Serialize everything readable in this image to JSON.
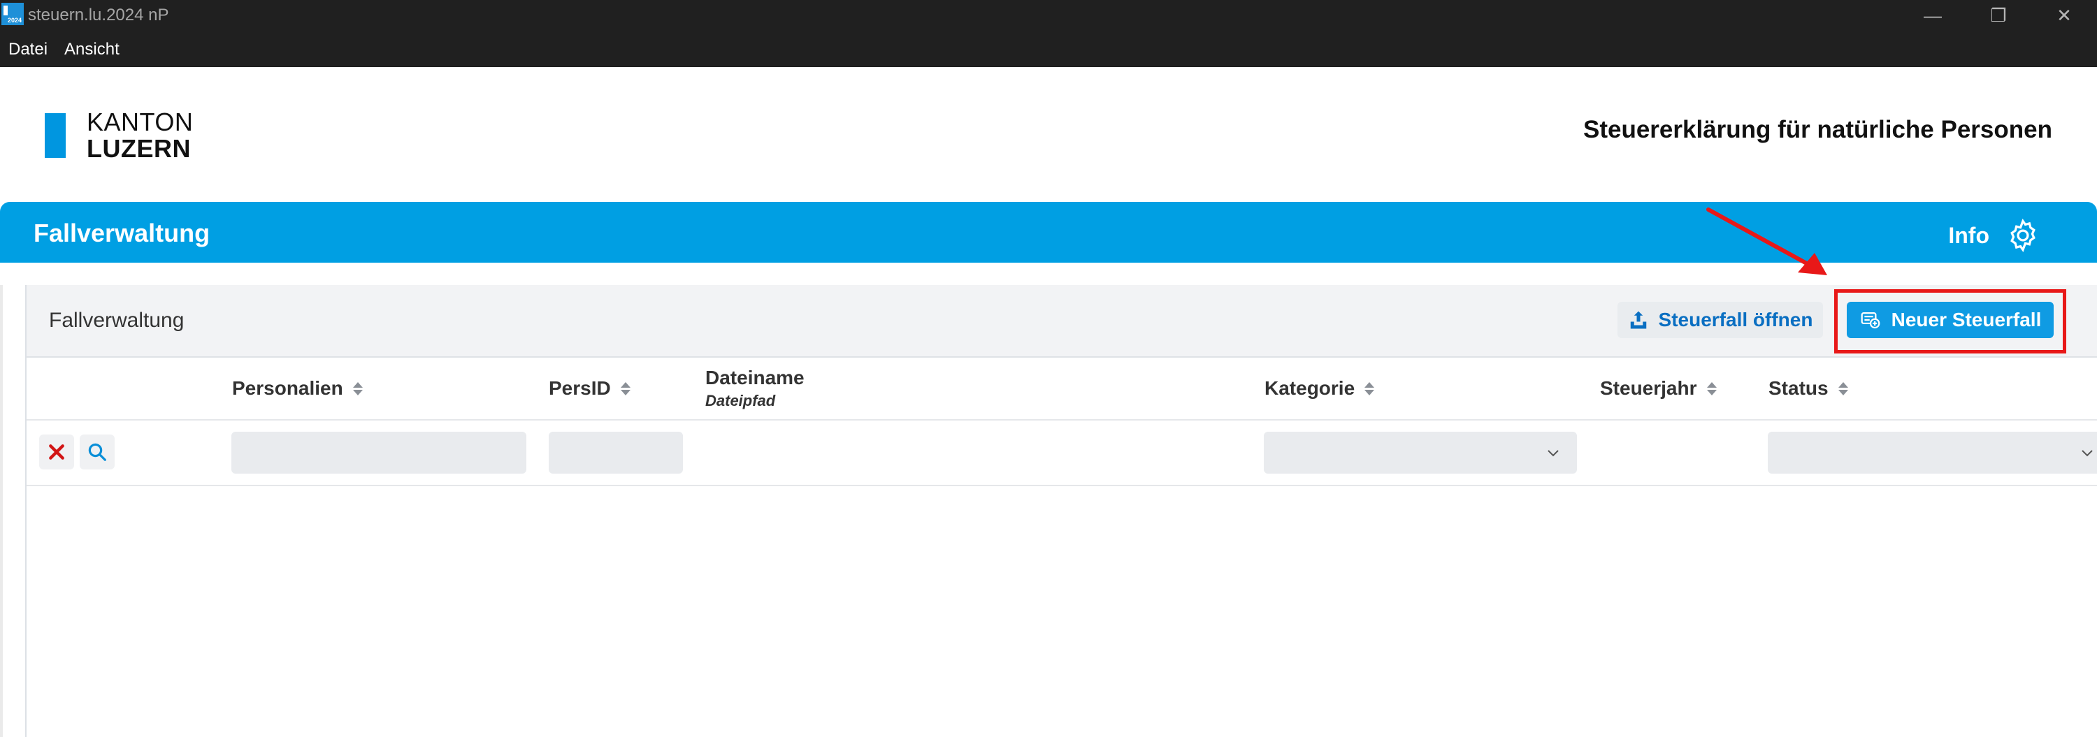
{
  "window": {
    "title": "steuern.lu.2024 nP",
    "icon_label": "2024",
    "controls": {
      "minimize": "—",
      "restore": "❐",
      "close": "✕"
    }
  },
  "menu": {
    "items": [
      "Datei",
      "Ansicht"
    ]
  },
  "header": {
    "logo_line1": "KANTON",
    "logo_line2": "LUZERN",
    "title": "Steuererklärung für natürliche Personen"
  },
  "nav": {
    "title": "Fallverwaltung",
    "info_label": "Info"
  },
  "panel": {
    "title": "Fallverwaltung",
    "open_button": "Steuerfall öffnen",
    "new_button": "Neuer Steuerfall"
  },
  "table": {
    "columns": {
      "personalien": "Personalien",
      "persid": "PersID",
      "dateiname": "Dateiname",
      "dateipfad": "Dateipfad",
      "kategorie": "Kategorie",
      "steuerjahr": "Steuerjahr",
      "status": "Status"
    },
    "rows": []
  },
  "colors": {
    "brand_blue": "#009fe3",
    "button_blue": "#0f9be3",
    "highlight_red": "#e81818"
  }
}
